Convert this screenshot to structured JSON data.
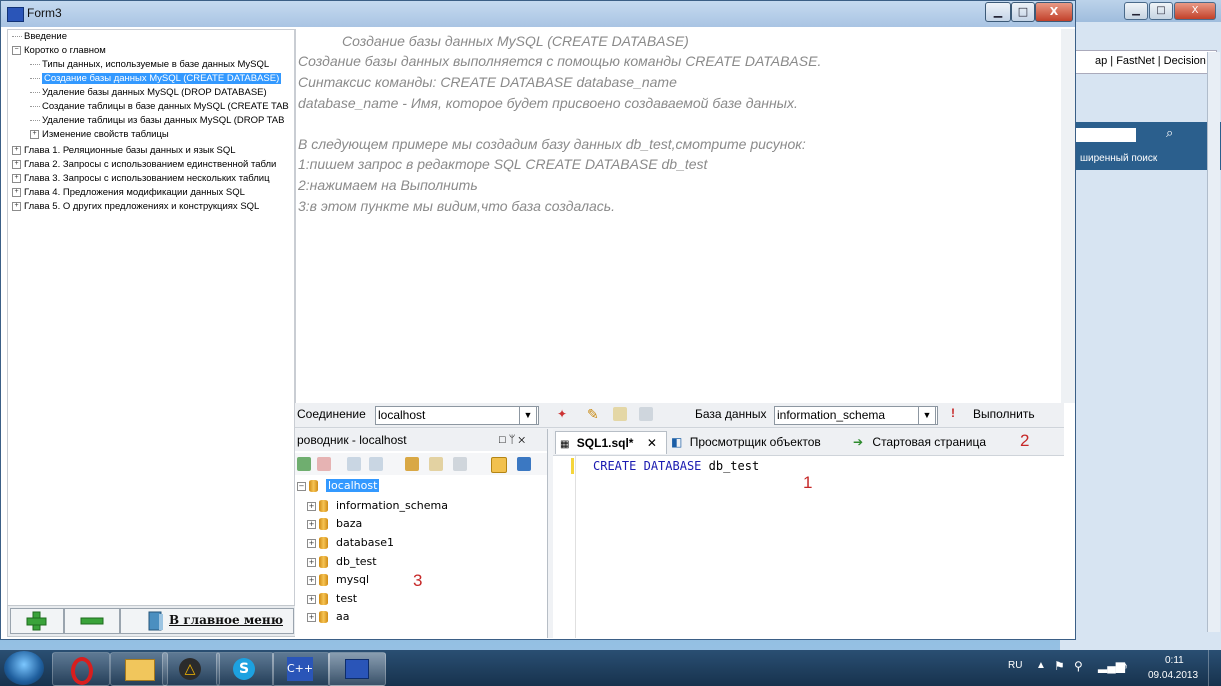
{
  "window": {
    "title": "Form3",
    "min": "▁",
    "max": "□",
    "close": "X"
  },
  "background_window": {
    "tabs": "ар | FastNet | Decision",
    "search_label": "ширенный поиск",
    "min": "▁",
    "max": "□",
    "close": "X"
  },
  "tree": {
    "items": [
      "Введение",
      "Коротко о главном",
      "Типы данных, используемые в базе данных MySQL",
      "Создание базы данных MySQL (CREATE DATABASE)",
      "Удаление базы данных MySQL (DROP DATABASE)",
      "Создание таблицы в базе данных MySQL (CREATE TAB",
      "Удаление таблицы из базы данных MySQL (DROP TAB",
      "Изменение свойств таблицы",
      "Глава 1. Реляционные базы данных и язык SQL",
      "Глава 2. Запросы с использованием единственной табли",
      "Глава 3. Запросы с использованием нескольких таблиц",
      "Глава 4. Предложения модификации данных SQL",
      "Глава 5. О других предложениях и конструкциях SQL"
    ],
    "expanders": [
      "",
      "−",
      "",
      "",
      "",
      "",
      "",
      "+",
      "+",
      "+",
      "+",
      "+",
      "+"
    ]
  },
  "bottom_bar": {
    "main_menu": "В главное меню"
  },
  "content": {
    "lines": [
      "Создание базы данных MySQL (CREATE DATABASE)",
      "Создание базы данных выполняется с помощью команды CREATE DATABASE.",
      "Синтаксис команды: CREATE DATABASE database_name",
      "database_name - Имя, которое будет присвоено создаваемой базе данных.",
      "В следующем примере мы создадим базу данных db_test,смотрите рисунок:",
      "1:пишем запрос в редакторе SQL       CREATE DATABASE db_test",
      "2:нажимаем на Выполнить",
      "3:в этом пункте мы видим,что база создалась."
    ]
  },
  "screenshot": {
    "connection_label": "Соединение",
    "connection_value": "localhost",
    "database_label": "База данных",
    "database_value": "information_schema",
    "execute": "Выполнить",
    "explorer_title": "роводник - localhost",
    "explorer_buttons": "□ ᛘ ✕",
    "tabs": [
      "SQL1.sql*",
      "Просмотрщик объектов",
      "Стартовая страница"
    ],
    "tab_close": "✕",
    "code_kw1": "CREATE",
    "code_kw2": "DATABASE",
    "code_name": "db_test",
    "databases": [
      "localhost",
      "information_schema",
      "baza",
      "database1",
      "db_test",
      "mysql",
      "test",
      "aa"
    ],
    "annotations": [
      "1",
      "2",
      "3"
    ]
  },
  "taskbar": {
    "lang": "RU",
    "time": "0:11",
    "date": "09.04.2013"
  }
}
